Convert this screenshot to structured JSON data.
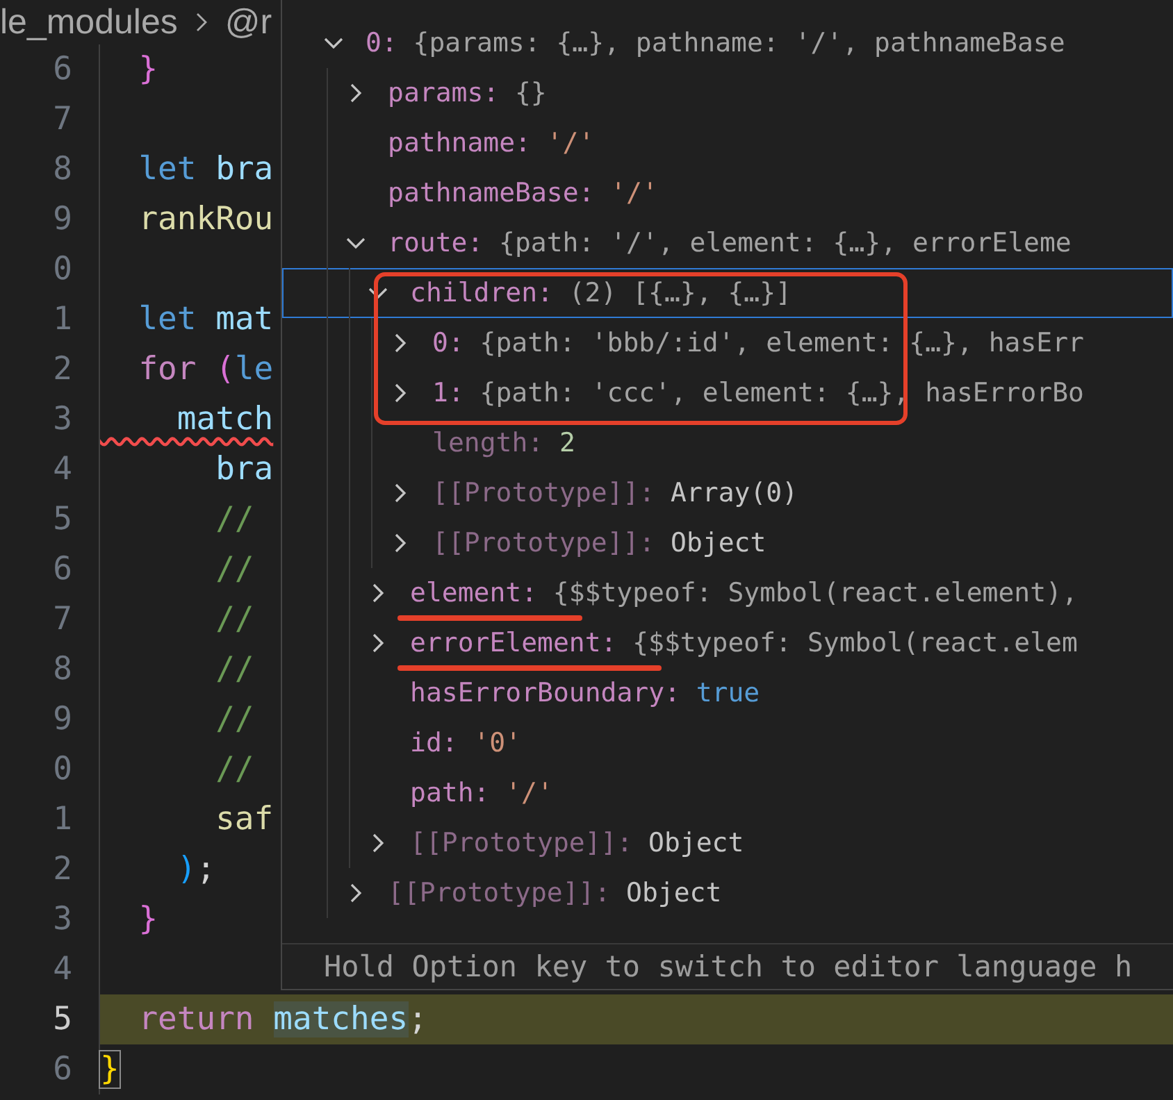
{
  "breadcrumb": [
    "le_modules",
    "@r"
  ],
  "editor": {
    "lines": [
      {
        "number": "6",
        "current": false,
        "tokens": [
          {
            "text": "  }",
            "kind": "bracket"
          }
        ]
      },
      {
        "number": "7",
        "current": false
      },
      {
        "number": "8",
        "current": false,
        "tokens": [
          {
            "text": "  let",
            "kind": "keyword"
          },
          {
            "text": " bra",
            "kind": "variable"
          }
        ]
      },
      {
        "number": "9",
        "current": false,
        "tokens": [
          {
            "text": "  rankRou",
            "kind": "function"
          }
        ]
      },
      {
        "number": "0",
        "current": false
      },
      {
        "number": "1",
        "current": false,
        "tokens": [
          {
            "text": "  let",
            "kind": "keyword"
          },
          {
            "text": " mat",
            "kind": "variable"
          }
        ]
      },
      {
        "number": "2",
        "current": false,
        "tokens": [
          {
            "text": "  for",
            "kind": "control"
          },
          {
            "text": " (",
            "kind": "bracket"
          },
          {
            "text": "le",
            "kind": "keyword"
          }
        ]
      },
      {
        "number": "3",
        "current": false,
        "tokens": [
          {
            "text": "    match",
            "kind": "variable",
            "error": true
          }
        ]
      },
      {
        "number": "4",
        "current": false,
        "tokens": [
          {
            "text": "      bra",
            "kind": "variable"
          }
        ]
      },
      {
        "number": "5",
        "current": false,
        "tokens": [
          {
            "text": "      //",
            "kind": "comment"
          }
        ]
      },
      {
        "number": "6",
        "current": false,
        "tokens": [
          {
            "text": "      //",
            "kind": "comment"
          }
        ]
      },
      {
        "number": "7",
        "current": false,
        "tokens": [
          {
            "text": "      //",
            "kind": "comment"
          }
        ]
      },
      {
        "number": "8",
        "current": false,
        "tokens": [
          {
            "text": "      //",
            "kind": "comment"
          }
        ]
      },
      {
        "number": "9",
        "current": false,
        "tokens": [
          {
            "text": "      //",
            "kind": "comment"
          }
        ]
      },
      {
        "number": "0",
        "current": false,
        "tokens": [
          {
            "text": "      //",
            "kind": "comment"
          }
        ]
      },
      {
        "number": "1",
        "current": false,
        "tokens": [
          {
            "text": "      saf",
            "kind": "function"
          }
        ]
      },
      {
        "number": "2",
        "current": false,
        "tokens": [
          {
            "text": "    )",
            "kind": "paren"
          },
          {
            "text": ";",
            "kind": "punct"
          }
        ]
      },
      {
        "number": "3",
        "current": false,
        "tokens": [
          {
            "text": "  }",
            "kind": "bracket"
          }
        ]
      },
      {
        "number": "4",
        "current": false
      },
      {
        "number": "5",
        "current": true,
        "tokens": [
          {
            "text": "  return ",
            "kind": "control"
          },
          {
            "text": "matches",
            "kind": "variable",
            "highlighted": true
          },
          {
            "text": ";",
            "kind": "punct"
          }
        ]
      },
      {
        "number": "6",
        "current": false,
        "tokens": [
          {
            "text": "}",
            "kind": "outer_bracket",
            "matched": true
          }
        ]
      }
    ]
  },
  "hover": {
    "tree": [
      {
        "kind": "group",
        "expanded": true,
        "selected": false,
        "dim": false,
        "name": "0:",
        "value": {
          "text": "{params: {…}, pathname: '/', pathnameBase",
          "kind": "preview"
        },
        "children": [
          {
            "kind": "group",
            "expanded": false,
            "selected": false,
            "dim": false,
            "name": "params:",
            "value": {
              "text": "{}",
              "kind": "preview"
            }
          },
          {
            "kind": "leaf",
            "selected": false,
            "dim": false,
            "name": "pathname:",
            "value": {
              "text": "'/'",
              "kind": "string"
            }
          },
          {
            "kind": "leaf",
            "selected": false,
            "dim": false,
            "name": "pathnameBase:",
            "value": {
              "text": "'/'",
              "kind": "string"
            }
          },
          {
            "kind": "group",
            "expanded": true,
            "selected": false,
            "dim": false,
            "name": "route:",
            "value": {
              "text": "{path: '/', element: {…}, errorEleme",
              "kind": "preview"
            },
            "children": [
              {
                "kind": "group",
                "expanded": true,
                "selected": true,
                "dim": false,
                "boxed": true,
                "name": "children:",
                "value": {
                  "text": "(2) [{…}, {…}]",
                  "kind": "preview"
                },
                "children": [
                  {
                    "kind": "group",
                    "expanded": false,
                    "selected": false,
                    "dim": false,
                    "boxed": true,
                    "name": "0:",
                    "value": {
                      "text": "{path: 'bbb/:id', element: {…}, hasErr",
                      "kind": "preview"
                    }
                  },
                  {
                    "kind": "group",
                    "expanded": false,
                    "selected": false,
                    "dim": false,
                    "boxed": true,
                    "name": "1:",
                    "value": {
                      "text": "{path: 'ccc', element: {…}, hasErrorBo",
                      "kind": "preview"
                    }
                  },
                  {
                    "kind": "leaf",
                    "selected": false,
                    "dim": true,
                    "name": "length:",
                    "value": {
                      "text": "2",
                      "kind": "number"
                    }
                  },
                  {
                    "kind": "group",
                    "expanded": false,
                    "selected": false,
                    "dim": true,
                    "name": "[[Prototype]]:",
                    "value": {
                      "text": "Array(0)",
                      "kind": "object"
                    }
                  },
                  {
                    "kind": "group",
                    "expanded": false,
                    "selected": false,
                    "dim": true,
                    "name": "[[Prototype]]:",
                    "value": {
                      "text": "Object",
                      "kind": "object"
                    }
                  }
                ]
              },
              {
                "kind": "group",
                "expanded": false,
                "selected": false,
                "dim": false,
                "underlined": true,
                "name": "element:",
                "value": {
                  "text": "{$$typeof: Symbol(react.element),",
                  "kind": "preview"
                }
              },
              {
                "kind": "group",
                "expanded": false,
                "selected": false,
                "dim": false,
                "underlined": true,
                "name": "errorElement:",
                "value": {
                  "text": "{$$typeof: Symbol(react.elem",
                  "kind": "preview"
                }
              },
              {
                "kind": "leaf",
                "selected": false,
                "dim": false,
                "name": "hasErrorBoundary:",
                "value": {
                  "text": "true",
                  "kind": "boolean"
                }
              },
              {
                "kind": "leaf",
                "selected": false,
                "dim": false,
                "name": "id:",
                "value": {
                  "text": "'0'",
                  "kind": "string"
                }
              },
              {
                "kind": "leaf",
                "selected": false,
                "dim": false,
                "name": "path:",
                "value": {
                  "text": "'/'",
                  "kind": "string"
                }
              },
              {
                "kind": "group",
                "expanded": false,
                "selected": false,
                "dim": true,
                "name": "[[Prototype]]:",
                "value": {
                  "text": "Object",
                  "kind": "object"
                }
              }
            ]
          },
          {
            "kind": "group",
            "expanded": false,
            "selected": false,
            "dim": true,
            "name": "[[Prototype]]:",
            "value": {
              "text": "Object",
              "kind": "object"
            }
          }
        ]
      }
    ],
    "status": "Hold Option key to switch to editor language h"
  }
}
